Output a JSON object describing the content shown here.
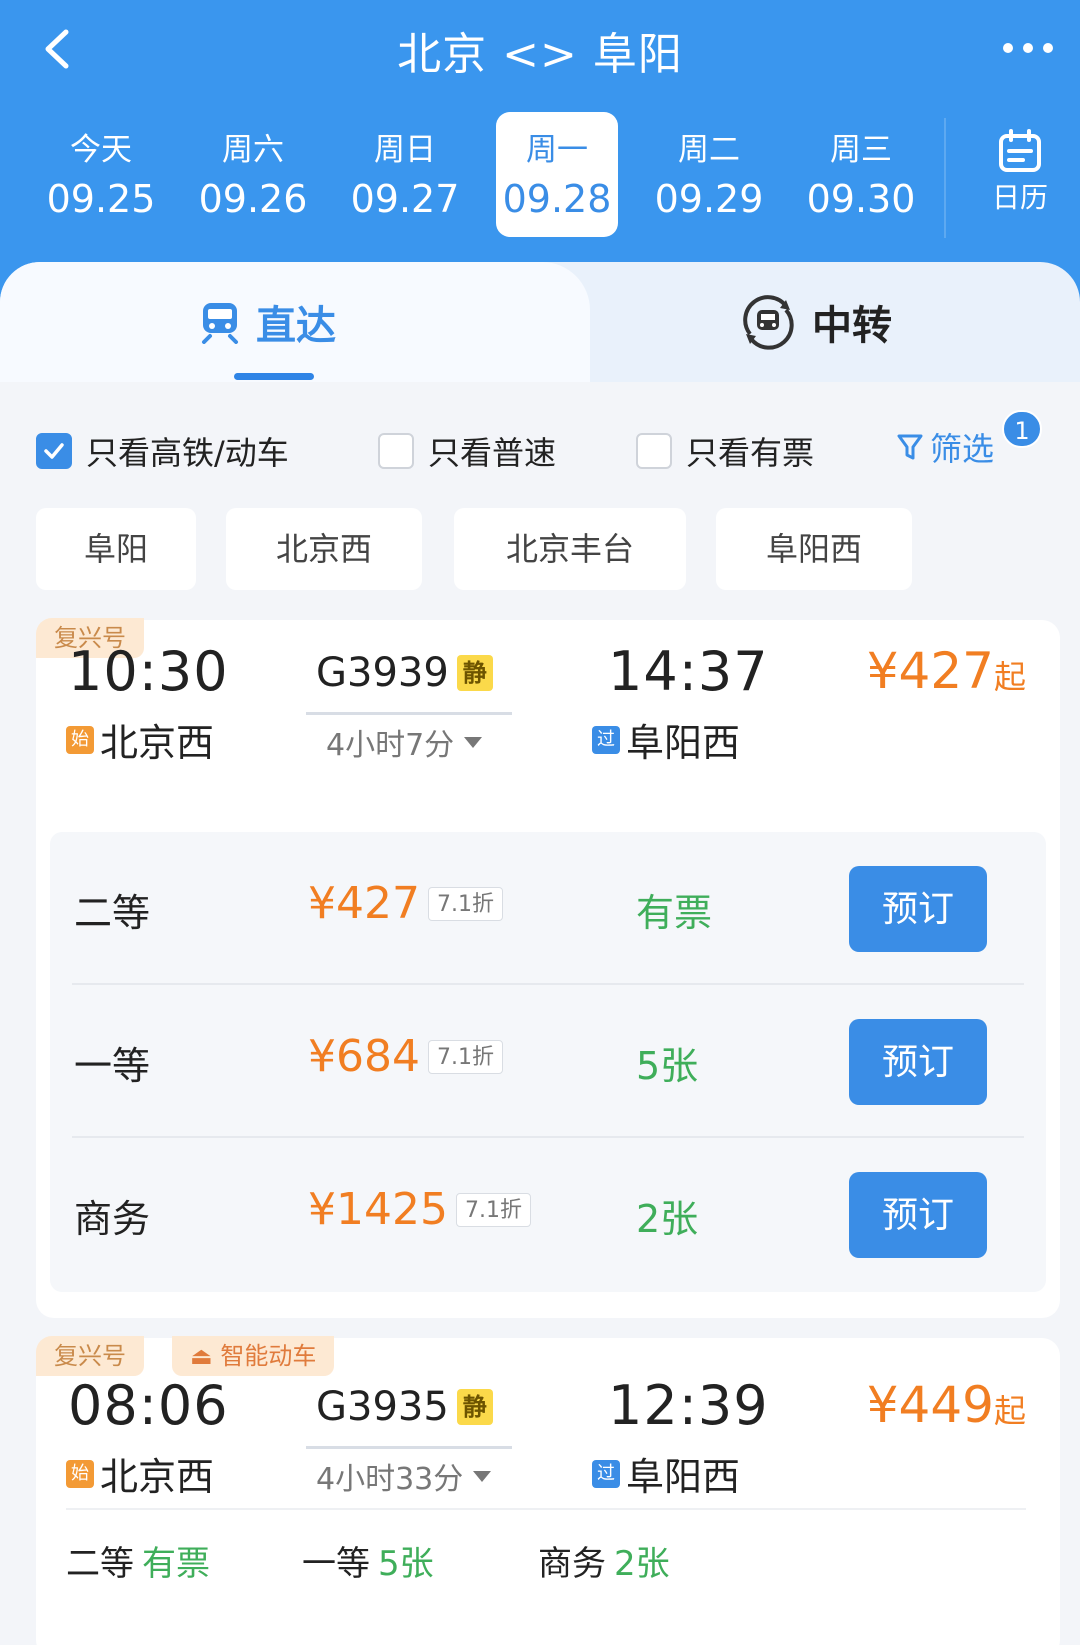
{
  "header": {
    "title": "北京 <> 阜阳",
    "back_icon": "chevron-left-icon",
    "more_icon": "more-dots-icon"
  },
  "dates": [
    {
      "dow": "今天",
      "date": "09.25",
      "active": false
    },
    {
      "dow": "周六",
      "date": "09.26",
      "active": false
    },
    {
      "dow": "周日",
      "date": "09.27",
      "active": false
    },
    {
      "dow": "周一",
      "date": "09.28",
      "active": true
    },
    {
      "dow": "周二",
      "date": "09.29",
      "active": false
    },
    {
      "dow": "周三",
      "date": "09.30",
      "active": false
    }
  ],
  "calendar": {
    "label": "日历",
    "icon": "calendar-icon"
  },
  "tabs": {
    "direct": {
      "label": "直达",
      "icon": "train-icon",
      "active": true
    },
    "transfer": {
      "label": "中转",
      "icon": "transfer-train-icon",
      "active": false
    }
  },
  "filters": {
    "high_speed": {
      "label": "只看高铁/动车",
      "checked": true
    },
    "normal": {
      "label": "只看普速",
      "checked": false
    },
    "available": {
      "label": "只看有票",
      "checked": false
    },
    "filter_label": "筛选",
    "filter_badge": "1",
    "filter_icon": "funnel-icon"
  },
  "stations": [
    "阜阳",
    "北京西",
    "北京丰台",
    "阜阳西"
  ],
  "trains": [
    {
      "tags": [
        "复兴号"
      ],
      "dep_time": "10:30",
      "dep_station": "北京西",
      "dep_marker": "始",
      "train_no": "G3939",
      "quiet": "静",
      "duration": "4小时7分",
      "arr_time": "14:37",
      "arr_station": "阜阳西",
      "arr_marker": "过",
      "price": "¥427",
      "price_suffix": "起",
      "seats": [
        {
          "name": "二等",
          "price": "¥427",
          "discount": "7.1折",
          "avail": "有票",
          "book": "预订"
        },
        {
          "name": "一等",
          "price": "¥684",
          "discount": "7.1折",
          "avail": "5张",
          "book": "预订"
        },
        {
          "name": "商务",
          "price": "¥1425",
          "discount": "7.1折",
          "avail": "2张",
          "book": "预订"
        }
      ]
    },
    {
      "tags": [
        "复兴号",
        "智能动车"
      ],
      "dep_time": "08:06",
      "dep_station": "北京西",
      "dep_marker": "始",
      "train_no": "G3935",
      "quiet": "静",
      "duration": "4小时33分",
      "arr_time": "12:39",
      "arr_station": "阜阳西",
      "arr_marker": "过",
      "price": "¥449",
      "price_suffix": "起",
      "summary": [
        {
          "name": "二等",
          "avail": "有票"
        },
        {
          "name": "一等",
          "avail": "5张"
        },
        {
          "name": "商务",
          "avail": "2张"
        }
      ]
    }
  ],
  "colors": {
    "brand": "#3a96ee",
    "price": "#f17e22",
    "available": "#3fae5a"
  }
}
